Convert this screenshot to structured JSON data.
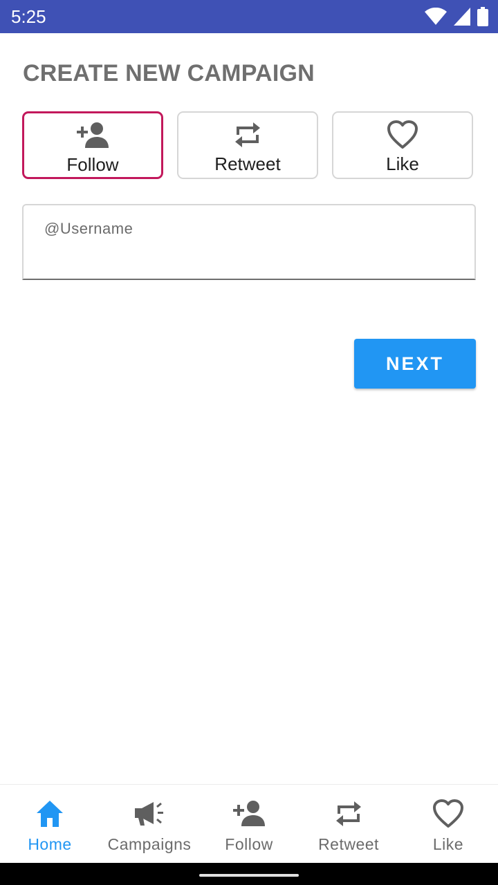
{
  "status_bar": {
    "time": "5:25",
    "icons": [
      "wifi-icon",
      "cellular-signal-icon",
      "battery-icon"
    ]
  },
  "page": {
    "title": "CREATE NEW CAMPAIGN"
  },
  "campaign_types": [
    {
      "label": "Follow",
      "icon": "person-add-icon",
      "selected": true
    },
    {
      "label": "Retweet",
      "icon": "retweet-icon",
      "selected": false
    },
    {
      "label": "Like",
      "icon": "heart-icon",
      "selected": false
    }
  ],
  "username_field": {
    "placeholder": "@Username",
    "value": ""
  },
  "next_button": {
    "label": "NEXT"
  },
  "bottom_nav": {
    "items": [
      {
        "label": "Home",
        "icon": "home-icon",
        "active": true
      },
      {
        "label": "Campaigns",
        "icon": "megaphone-icon",
        "active": false
      },
      {
        "label": "Follow",
        "icon": "person-add-icon",
        "active": false
      },
      {
        "label": "Retweet",
        "icon": "retweet-icon",
        "active": false
      },
      {
        "label": "Like",
        "icon": "heart-icon",
        "active": false
      }
    ]
  },
  "colors": {
    "status_bar": "#3f51b5",
    "accent": "#2196f3",
    "selected_border": "#c2185b",
    "title_text": "#6f6f6f",
    "icon_gray": "#5f5f5f"
  }
}
